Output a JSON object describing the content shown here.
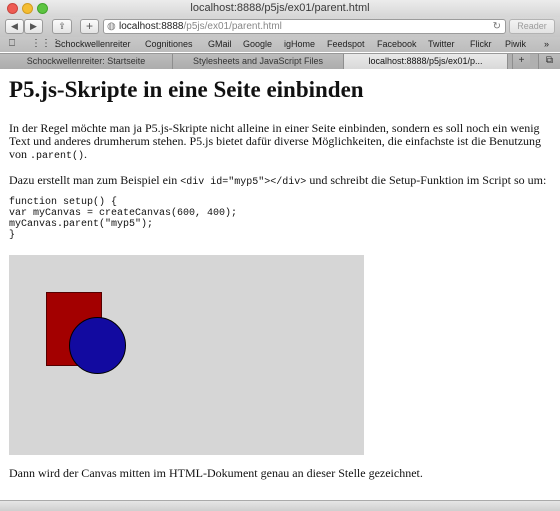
{
  "window": {
    "title": "localhost:8888/p5js/ex01/parent.html"
  },
  "toolbar": {
    "back": "◀",
    "forward": "▶",
    "share": "⇪",
    "new_tab": "+",
    "url_host": "localhost:8888",
    "url_path": "/p5js/ex01/parent.html",
    "reader": "Reader",
    "reload_icon": "reload-icon"
  },
  "bookmarks": {
    "items": [
      "Schockwellenreiter",
      "Cognitiones",
      "GMail",
      "Google",
      "igHome",
      "Feedspot",
      "Facebook",
      "Twitter",
      "Flickr",
      "Piwik"
    ],
    "overflow": "»"
  },
  "tabs": [
    {
      "label": "Schockwellenreiter: Startseite",
      "active": false
    },
    {
      "label": "Stylesheets and JavaScript Files",
      "active": false
    },
    {
      "label": "localhost:8888/p5js/ex01/p...",
      "active": true
    }
  ],
  "page": {
    "heading": "P5.js-Skripte in eine Seite einbinden",
    "p1_text": "In der Regel möchte man ja P5.js-Skripte nicht alleine in einer Seite einbinden, sondern es soll noch ein wenig Text und anderes drumherum stehen. P5.js bietet dafür diverse Möglichkeiten, die einfachste ist die Benutzung von ",
    "p1_code": ".parent()",
    "p1_end": ".",
    "p2_text": "Dazu erstellt man zum Beispiel ein ",
    "p2_code": "<div id=\"myp5\"></div>",
    "p2_end": " und schreibt die Setup-Funktion im Script so um:",
    "code": "function setup() {\nvar myCanvas = createCanvas(600, 400);\nmyCanvas.parent(\"myp5\");\n}",
    "p3_text": "Dann wird der Canvas mitten im HTML-Dokument genau an dieser Stelle gezeichnet.",
    "canvas": {
      "background": "#d6d6d6",
      "rect_color": "#a30000",
      "circle_color": "#120aa0"
    }
  }
}
